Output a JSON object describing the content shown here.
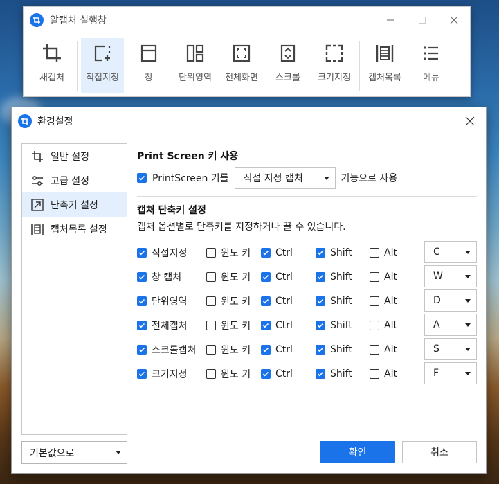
{
  "capture_window": {
    "title": "알캡처 실행창",
    "tools": [
      {
        "label": "새캡처",
        "icon": "crop-icon",
        "active": false
      },
      {
        "label": "직접지정",
        "icon": "region-select-icon",
        "active": true
      },
      {
        "label": "창",
        "icon": "window-icon",
        "active": false
      },
      {
        "label": "단위영역",
        "icon": "unit-area-icon",
        "active": false
      },
      {
        "label": "전체화면",
        "icon": "fullscreen-icon",
        "active": false
      },
      {
        "label": "스크롤",
        "icon": "scroll-icon",
        "active": false
      },
      {
        "label": "크기지정",
        "icon": "fixed-size-icon",
        "active": false
      },
      {
        "label": "캡처목록",
        "icon": "capture-list-icon",
        "active": false
      },
      {
        "label": "메뉴",
        "icon": "menu-icon",
        "active": false
      }
    ]
  },
  "settings_dialog": {
    "title": "환경설정",
    "sidebar": [
      {
        "label": "일반 설정",
        "icon": "crop-icon",
        "active": false
      },
      {
        "label": "고급 설정",
        "icon": "sliders-icon",
        "active": false
      },
      {
        "label": "단축키 설정",
        "icon": "shortcut-arrow-icon",
        "active": true
      },
      {
        "label": "캡처목록 설정",
        "icon": "capture-list-icon",
        "active": false
      }
    ],
    "printscreen": {
      "section_title": "Print Screen 키 사용",
      "checkbox_label": "PrintScreen 키를",
      "checked": true,
      "selected_mode": "직접 지정 캡처",
      "suffix": "기능으로 사용"
    },
    "hotkeys": {
      "section_title": "캡처 단축키 설정",
      "description": "캡처 옵션별로 단축키를 지정하거나 끌 수 있습니다.",
      "modifier_labels": {
        "win": "윈도 키",
        "ctrl": "Ctrl",
        "shift": "Shift",
        "alt": "Alt"
      },
      "rows": [
        {
          "name": "직접지정",
          "enabled": true,
          "win": false,
          "ctrl": true,
          "shift": true,
          "alt": false,
          "key": "C"
        },
        {
          "name": "창 캡처",
          "enabled": true,
          "win": false,
          "ctrl": true,
          "shift": true,
          "alt": false,
          "key": "W"
        },
        {
          "name": "단위영역",
          "enabled": true,
          "win": false,
          "ctrl": true,
          "shift": true,
          "alt": false,
          "key": "D"
        },
        {
          "name": "전체캡처",
          "enabled": true,
          "win": false,
          "ctrl": true,
          "shift": true,
          "alt": false,
          "key": "A"
        },
        {
          "name": "스크롤캡처",
          "enabled": true,
          "win": false,
          "ctrl": true,
          "shift": true,
          "alt": false,
          "key": "S"
        },
        {
          "name": "크기지정",
          "enabled": true,
          "win": false,
          "ctrl": true,
          "shift": true,
          "alt": false,
          "key": "F"
        }
      ]
    },
    "defaults_button": "기본값으로",
    "ok_button": "확인",
    "cancel_button": "취소"
  },
  "colors": {
    "accent": "#1a73e8",
    "active_bg": "#e3effc"
  }
}
